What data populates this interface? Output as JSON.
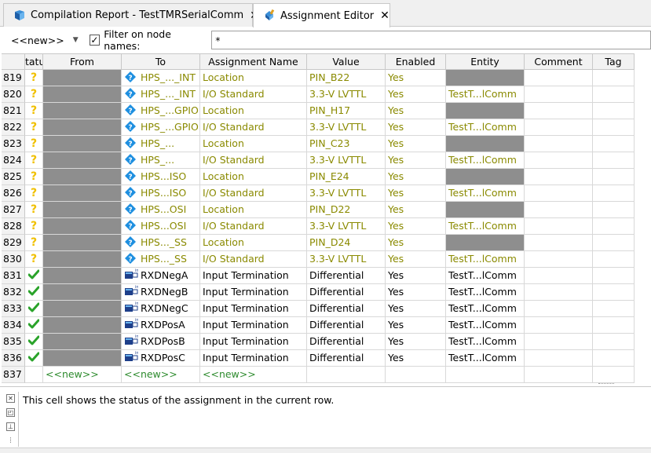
{
  "tabs": [
    {
      "label": "Compilation Report - TestTMRSerialComm",
      "icon": "report-icon",
      "active": false
    },
    {
      "label": "Assignment Editor",
      "icon": "assignment-editor-icon",
      "active": true
    }
  ],
  "filter": {
    "node_select": "<<new>>",
    "checkbox_checked": true,
    "label": "Filter on node names:",
    "value": "*"
  },
  "columns": [
    "tatu",
    "From",
    "To",
    "Assignment Name",
    "Value",
    "Enabled",
    "Entity",
    "Comment",
    "Tag"
  ],
  "rows": [
    {
      "num": "819",
      "status": "?",
      "to": "HPS_..._INT",
      "to_icon": "io-pin-icon",
      "name": "Location",
      "value": "PIN_B22",
      "enabled": "Yes",
      "entity": "",
      "olive": true
    },
    {
      "num": "820",
      "status": "?",
      "to": "HPS_..._INT",
      "to_icon": "io-pin-icon",
      "name": "I/O Standard",
      "value": "3.3-V LVTTL",
      "enabled": "Yes",
      "entity": "TestT...lComm",
      "olive": true
    },
    {
      "num": "821",
      "status": "?",
      "to": "HPS_...GPIO",
      "to_icon": "io-pin-icon",
      "name": "Location",
      "value": "PIN_H17",
      "enabled": "Yes",
      "entity": "",
      "olive": true
    },
    {
      "num": "822",
      "status": "?",
      "to": "HPS_...GPIO",
      "to_icon": "io-pin-icon",
      "name": "I/O Standard",
      "value": "3.3-V LVTTL",
      "enabled": "Yes",
      "entity": "TestT...lComm",
      "olive": true
    },
    {
      "num": "823",
      "status": "?",
      "to": "HPS_...",
      "to_icon": "io-pin-icon",
      "name": "Location",
      "value": "PIN_C23",
      "enabled": "Yes",
      "entity": "",
      "olive": true
    },
    {
      "num": "824",
      "status": "?",
      "to": "HPS_...",
      "to_icon": "io-pin-icon",
      "name": "I/O Standard",
      "value": "3.3-V LVTTL",
      "enabled": "Yes",
      "entity": "TestT...lComm",
      "olive": true
    },
    {
      "num": "825",
      "status": "?",
      "to": "HPS...ISO",
      "to_icon": "io-pin-icon",
      "name": "Location",
      "value": "PIN_E24",
      "enabled": "Yes",
      "entity": "",
      "olive": true
    },
    {
      "num": "826",
      "status": "?",
      "to": "HPS...ISO",
      "to_icon": "io-pin-icon",
      "name": "I/O Standard",
      "value": "3.3-V LVTTL",
      "enabled": "Yes",
      "entity": "TestT...lComm",
      "olive": true
    },
    {
      "num": "827",
      "status": "?",
      "to": "HPS...OSI",
      "to_icon": "io-pin-icon",
      "name": "Location",
      "value": "PIN_D22",
      "enabled": "Yes",
      "entity": "",
      "olive": true
    },
    {
      "num": "828",
      "status": "?",
      "to": "HPS...OSI",
      "to_icon": "io-pin-icon",
      "name": "I/O Standard",
      "value": "3.3-V LVTTL",
      "enabled": "Yes",
      "entity": "TestT...lComm",
      "olive": true
    },
    {
      "num": "829",
      "status": "?",
      "to": "HPS..._SS",
      "to_icon": "io-pin-icon",
      "name": "Location",
      "value": "PIN_D24",
      "enabled": "Yes",
      "entity": "",
      "olive": true
    },
    {
      "num": "830",
      "status": "?",
      "to": "HPS..._SS",
      "to_icon": "io-pin-icon",
      "name": "I/O Standard",
      "value": "3.3-V LVTTL",
      "enabled": "Yes",
      "entity": "TestT...lComm",
      "olive": true
    },
    {
      "num": "831",
      "status": "ok",
      "to": "RXDNegA",
      "to_icon": "input-pin-icon",
      "name": "Input Termination",
      "value": "Differential",
      "enabled": "Yes",
      "entity": "TestT...lComm",
      "olive": false
    },
    {
      "num": "832",
      "status": "ok",
      "to": "RXDNegB",
      "to_icon": "input-pin-icon",
      "name": "Input Termination",
      "value": "Differential",
      "enabled": "Yes",
      "entity": "TestT...lComm",
      "olive": false
    },
    {
      "num": "833",
      "status": "ok",
      "to": "RXDNegC",
      "to_icon": "input-pin-icon",
      "name": "Input Termination",
      "value": "Differential",
      "enabled": "Yes",
      "entity": "TestT...lComm",
      "olive": false
    },
    {
      "num": "834",
      "status": "ok",
      "to": "RXDPosA",
      "to_icon": "input-pin-icon",
      "name": "Input Termination",
      "value": "Differential",
      "enabled": "Yes",
      "entity": "TestT...lComm",
      "olive": false
    },
    {
      "num": "835",
      "status": "ok",
      "to": "RXDPosB",
      "to_icon": "input-pin-icon",
      "name": "Input Termination",
      "value": "Differential",
      "enabled": "Yes",
      "entity": "TestT...lComm",
      "olive": false
    },
    {
      "num": "836",
      "status": "ok",
      "to": "RXDPosC",
      "to_icon": "input-pin-icon",
      "name": "Input Termination",
      "value": "Differential",
      "enabled": "Yes",
      "entity": "TestT...lComm",
      "olive": false
    }
  ],
  "new_row": {
    "num": "837",
    "from": "<<new>>",
    "to": "<<new>>",
    "name": "<<new>>"
  },
  "message": "This cell shows the status of the assignment in the current row.",
  "colors": {
    "olive_text": "#8a8a00",
    "new_text": "#2e8b2e",
    "redacted": "#8e8e8e",
    "status_question": "#f0c000",
    "status_ok": "#2aa32a"
  }
}
